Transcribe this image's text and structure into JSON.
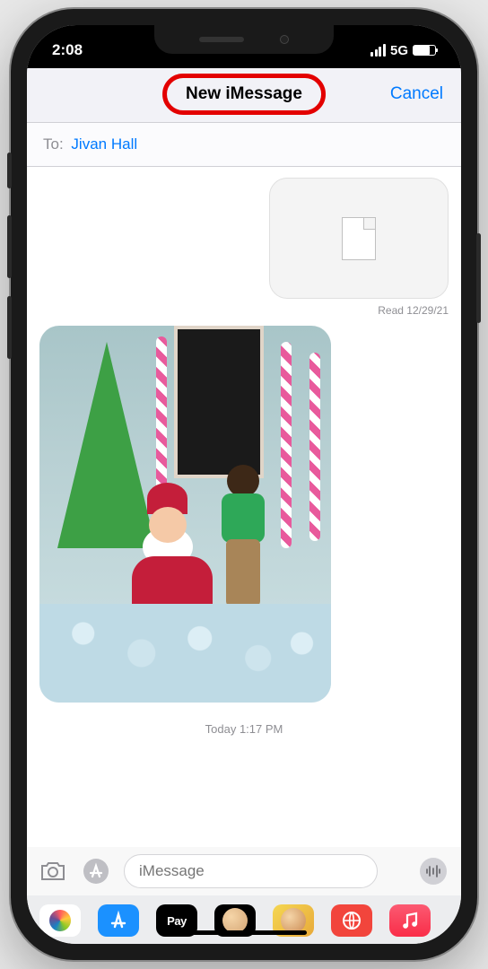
{
  "status": {
    "time": "2:08",
    "network": "5G"
  },
  "header": {
    "title": "New iMessage",
    "cancel": "Cancel"
  },
  "to": {
    "label": "To:",
    "recipient": "Jivan Hall"
  },
  "messages": {
    "read_receipt": "Read 12/29/21",
    "timestamp": "Today 1:17 PM"
  },
  "compose": {
    "placeholder": "iMessage"
  },
  "apps": {
    "pay_label": "Pay"
  }
}
